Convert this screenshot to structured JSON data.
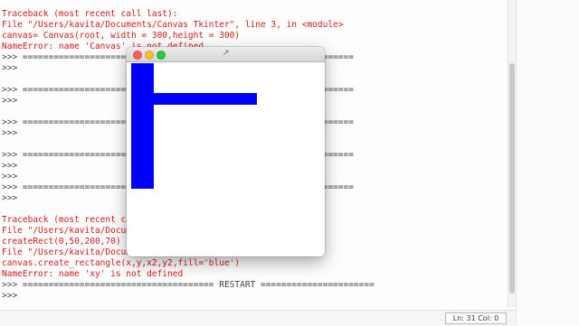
{
  "console": {
    "lines": [
      {
        "text": "Traceback (most recent call last):",
        "color": "#d41a1a"
      },
      {
        "text": "  File \"/Users/kavita/Documents/Canvas Tkinter\", line 3, in <module>",
        "color": "#d41a1a"
      },
      {
        "text": "    canvas= Canvas(root, width = 300,height = 300)",
        "color": "#d41a1a"
      },
      {
        "text": "NameError: name 'Canvas' is not defined",
        "color": "#d41a1a"
      },
      {
        "text": ">>> ================================================================",
        "color": "#444444"
      },
      {
        "text": ">>>",
        "color": "#444444"
      },
      {
        "text": "",
        "color": "#444444"
      },
      {
        "text": ">>> ================================================================",
        "color": "#444444"
      },
      {
        "text": ">>>",
        "color": "#444444"
      },
      {
        "text": "",
        "color": "#444444"
      },
      {
        "text": ">>> ================================================================",
        "color": "#444444"
      },
      {
        "text": ">>>",
        "color": "#444444"
      },
      {
        "text": "",
        "color": "#444444"
      },
      {
        "text": ">>> ================================================================",
        "color": "#444444"
      },
      {
        "text": ">>>",
        "color": "#444444"
      },
      {
        "text": ">>>",
        "color": "#444444"
      },
      {
        "text": ">>> ================================================================",
        "color": "#444444"
      },
      {
        "text": ">>>",
        "color": "#444444"
      },
      {
        "text": "",
        "color": "#444444"
      },
      {
        "text": "Traceback (most recent call last):",
        "color": "#d41a1a"
      },
      {
        "text": "  File \"/Users/kavita/Docum",
        "color": "#d41a1a"
      },
      {
        "text": "    createRect(0,50,200,70)",
        "color": "#d41a1a"
      },
      {
        "text": "  File \"/Users/kavita/Docum",
        "color": "#d41a1a"
      },
      {
        "text": "    canvas.create_rectangle(x,y,x2,y2,fill='blue')",
        "color": "#d41a1a"
      },
      {
        "text": "NameError: name 'xy' is not defined",
        "color": "#d41a1a"
      },
      {
        "text": ">>> ===================================== RESTART ======================",
        "color": "#444444"
      },
      {
        "text": ">>>",
        "color": "#444444"
      }
    ]
  },
  "statusbar": {
    "position": "Ln: 31 Col: 0"
  },
  "tk_window": {
    "title_glyph": "↗",
    "canvas": {
      "background": "#ffffff",
      "rect_color": "#0000ff",
      "rectangles": [
        {
          "name": "vertical-bar"
        },
        {
          "name": "horizontal-bar"
        }
      ]
    }
  }
}
